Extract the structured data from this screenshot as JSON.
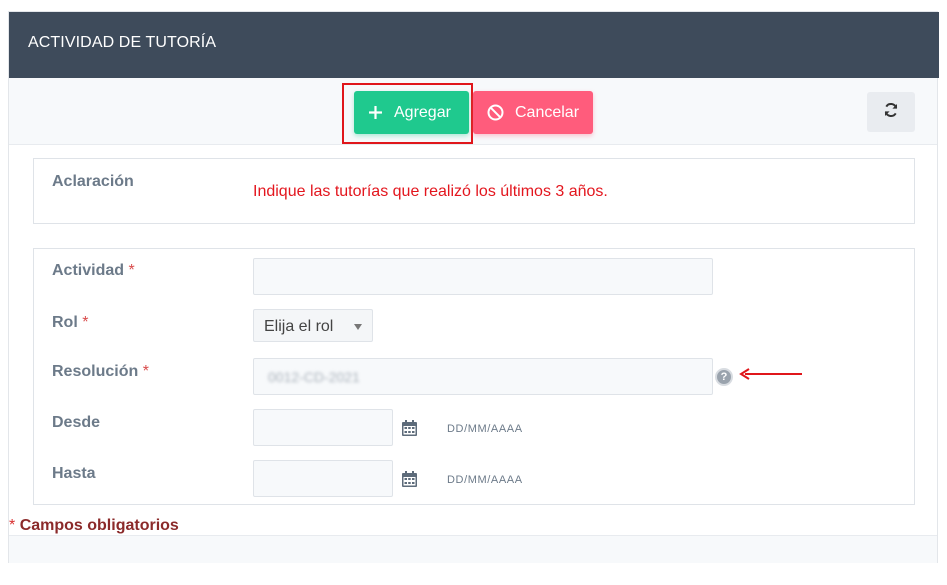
{
  "panel": {
    "title": "ACTIVIDAD DE TUTORÍA"
  },
  "toolbar": {
    "add_label": "Agregar",
    "add_icon": "plus-icon",
    "cancel_label": "Cancelar",
    "cancel_icon": "ban-icon",
    "refresh_icon": "refresh-icon",
    "colors": {
      "add": "#1fc98e",
      "cancel": "#ff5c7c",
      "highlight": "#e0161b"
    }
  },
  "note": {
    "label": "Aclaración",
    "text": "Indique las tutorías que realizó los últimos 3 años."
  },
  "form": {
    "required_mark": "*",
    "actividad": {
      "label": "Actividad",
      "value": ""
    },
    "rol": {
      "label": "Rol",
      "selected": "Elija el rol"
    },
    "resolucion": {
      "label": "Resolución",
      "value": "0012-CD-2021",
      "help": "?"
    },
    "desde": {
      "label": "Desde",
      "value": "",
      "format": "DD/MM/AAAA"
    },
    "hasta": {
      "label": "Hasta",
      "value": "",
      "format": "DD/MM/AAAA"
    }
  },
  "footer": {
    "required_note": "Campos obligatorios"
  }
}
